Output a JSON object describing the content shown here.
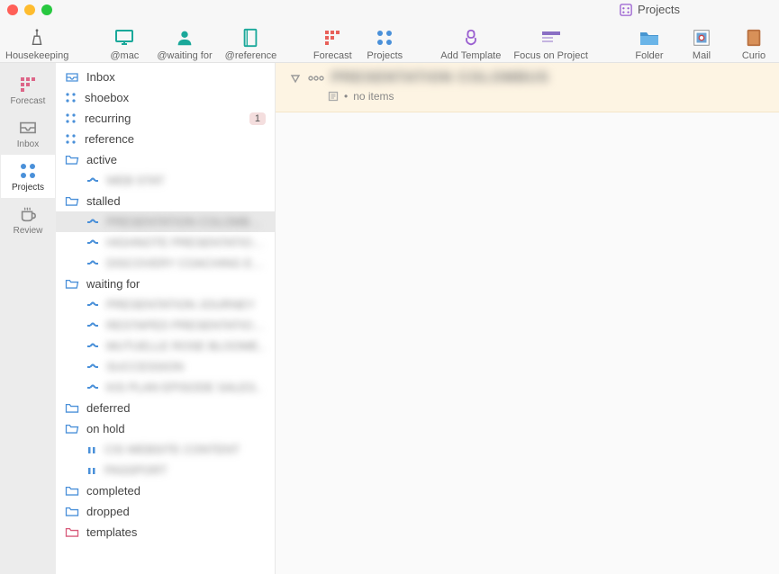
{
  "titlebar": {
    "label": "Projects"
  },
  "toolbar": {
    "housekeeping": "Housekeeping",
    "atmac": "@mac",
    "waiting": "@waiting for",
    "reference": "@reference",
    "forecast": "Forecast",
    "projects": "Projects",
    "addtemplate": "Add Template",
    "focus": "Focus on Project",
    "folder": "Folder",
    "mail": "Mail",
    "curio": "Curio"
  },
  "rail": {
    "forecast": "Forecast",
    "inbox": "Inbox",
    "projects": "Projects",
    "review": "Review"
  },
  "sidebar": {
    "inbox": "Inbox",
    "shoebox": "shoebox",
    "recurring": "recurring",
    "recurring_badge": "1",
    "reference": "reference",
    "active": "active",
    "active_items": [
      "WEB STAT"
    ],
    "stalled": "stalled",
    "stalled_items": [
      "PRESENTATION COLOMBUS",
      "HIGHNOTE PRESENTATION..",
      "DISCOVERY COACHING EXP L."
    ],
    "waitingfor": "waiting for",
    "waitingfor_items": [
      "PRESENTATION JOURNEY",
      "RESTAPED PRESENTATION..",
      "MUTUELLE ROSE BLOOME..",
      "SUCCESSION",
      "KIS PLAN EPISODE SALES.."
    ],
    "deferred": "deferred",
    "onhold": "on hold",
    "onhold_items": [
      "CIS WEBSITE CONTENT",
      "PASSPORT"
    ],
    "completed": "completed",
    "dropped": "dropped",
    "templates": "templates"
  },
  "content": {
    "project_title": "PRESENTATION COLOMBUS",
    "no_items": "no items"
  }
}
